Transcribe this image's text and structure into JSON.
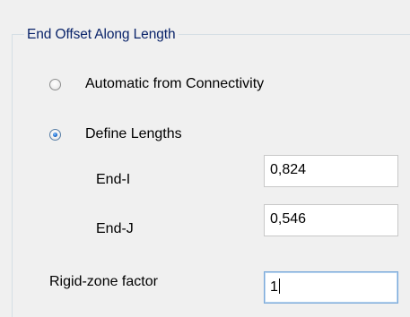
{
  "group": {
    "title": "End Offset Along Length"
  },
  "options": {
    "automatic_label": "Automatic from Connectivity",
    "automatic_selected": false,
    "define_label": "Define Lengths",
    "define_selected": true
  },
  "fields": {
    "end_i": {
      "label": "End-I",
      "value": "0,824"
    },
    "end_j": {
      "label": "End-J",
      "value": "0,546"
    },
    "rigid_zone": {
      "label": "Rigid-zone factor",
      "value": "1"
    }
  }
}
